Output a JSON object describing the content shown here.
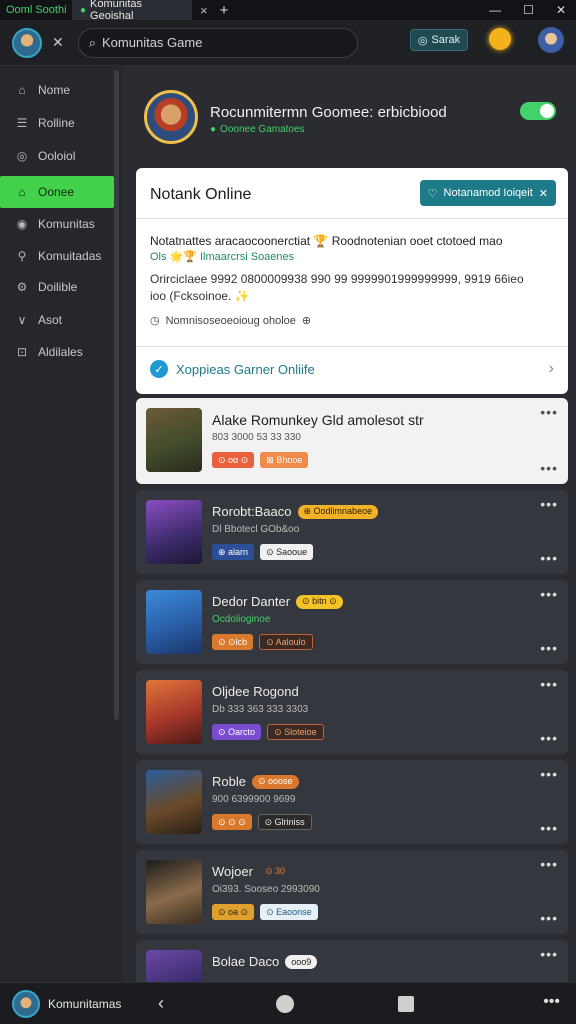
{
  "tabs": {
    "tab1": "Ooml Soothi",
    "tab2": "Komunitas Geoishal",
    "close": "×",
    "plus": "+"
  },
  "window": {
    "min": "—",
    "max": "☐",
    "close": "✕"
  },
  "topbar": {
    "search_placeholder": "Komunitas Game",
    "search_button": "Sarak",
    "close": "✕"
  },
  "sidebar": {
    "items": [
      {
        "label": "Nome",
        "icon": "home-icon"
      },
      {
        "label": "Rolline",
        "icon": "list-icon"
      },
      {
        "label": "Ooloiol",
        "icon": "globe-icon"
      },
      {
        "label": "Oonee",
        "icon": "game-icon",
        "active": true
      },
      {
        "label": "Komunitas",
        "icon": "people-icon"
      },
      {
        "label": "Komuitadas",
        "icon": "search-icon"
      },
      {
        "label": "Doilible",
        "icon": "settings-icon"
      },
      {
        "label": "Asot",
        "icon": "check-icon"
      },
      {
        "label": "Aldilales",
        "icon": "lock-icon"
      }
    ]
  },
  "profile": {
    "title": "Rocunmitermn Goomee: erbicbiood",
    "subtitle": "Ooonee Gamatoes"
  },
  "card": {
    "title": "Notank Online",
    "badge": "Notanamod Ioiqeit",
    "line1": "Notatnattes aracaocoonerctiat 🏆 Roodnotenian ooet ctotoed mao",
    "line2": "Ols 🌟🏆 Ilmaarcrsi Soaenes",
    "line3": "Orirciclaee 9992 0800009938 990 99 9999901999999999, 9919 66ieo",
    "line4": "ioo (Fcksoinoe. ✨",
    "line5": "Nomnisoseoeoioug oholoe",
    "footer": "Xoppieas Garner Onliife"
  },
  "games": [
    {
      "title": "Alake Romunkey Gld amolesot str",
      "sub": "803 3000 53 33 330",
      "sub_green": false,
      "tag1": "⊙ oα ⊙",
      "tag2": "⊠ Bhooe",
      "pill": ""
    },
    {
      "title": "Rorobt:Baaco",
      "sub": "Dl Bbotecl GOb&oo",
      "sub_green": false,
      "tag1": "⊕ alarn",
      "tag2": "⊙ Saooue",
      "pill": "⊕ Oodlimnabeoe"
    },
    {
      "title": "Dedor Danter",
      "sub": "Ocdolioginoe",
      "sub_green": true,
      "tag1": "⊙ ⊙lcb",
      "tag2": "⊙ Aaloulo",
      "pill": "⊙ bitn ⊙"
    },
    {
      "title": "Oljdee Rogond",
      "sub": "Db 333 363 333 3303",
      "sub_green": false,
      "tag1": "⊙ Oarcto",
      "tag2": "⊙ Sloteioe",
      "pill": ""
    },
    {
      "title": "Roble",
      "sub": "900 6399900 9699",
      "sub_green": false,
      "tag1": "⊙ ⊙ ⊙",
      "tag2": "⊙ Glriniss",
      "pill": "⊙ ooose"
    },
    {
      "title": "Wojoer",
      "sub": "Oi393. Sooseo 2993090",
      "sub_green": false,
      "tag1": "⊙ oa ⊙",
      "tag2": "⊙ Eaoonse",
      "pill": "⊙ 30"
    },
    {
      "title": "Bolae Daco",
      "sub": "",
      "sub_green": false,
      "tag1": "",
      "tag2": "",
      "pill": "ooo9"
    }
  ],
  "bottombar": {
    "label": "Komunitamas"
  },
  "colors": {
    "accent_green": "#43d16a",
    "teal": "#1d7a88",
    "bg": "#2a2c31"
  }
}
